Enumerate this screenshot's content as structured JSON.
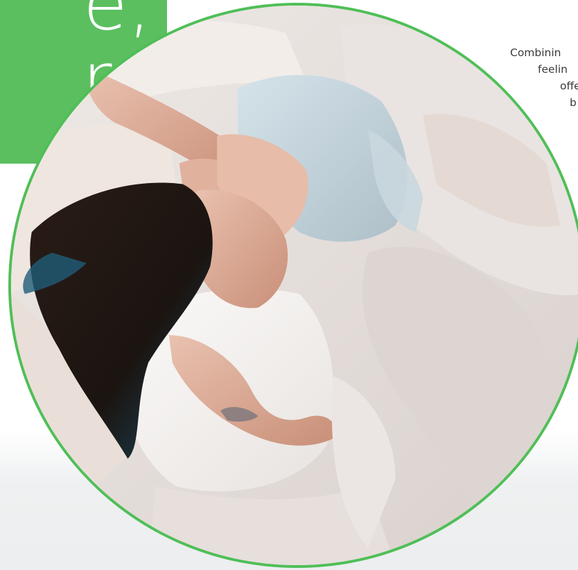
{
  "headline": {
    "line_1": "e,",
    "line_2": "ry",
    "background_color": "#5bbf5f",
    "text_color": "#ffffff"
  },
  "intro_text": {
    "lines": [
      "Combinin",
      "feelin",
      "offe",
      "b"
    ],
    "color": "#3a3a3a"
  },
  "hero_image": {
    "border_color": "#4fbf57",
    "subject": "woman sleeping in bed with pillow and duvet"
  }
}
